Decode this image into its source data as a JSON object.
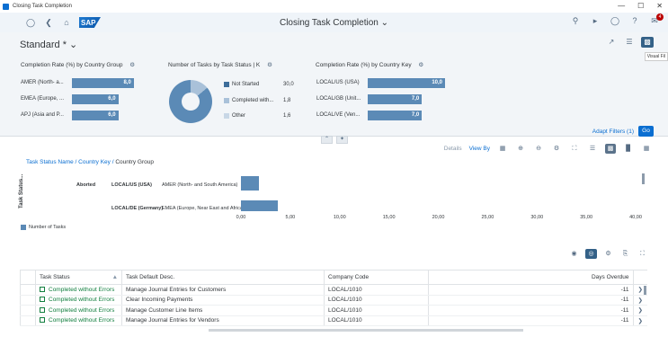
{
  "window": {
    "title": "Closing Task Completion",
    "controls": [
      "—",
      "☐",
      "✕"
    ]
  },
  "shell": {
    "logo": "SAP",
    "title": "Closing Task Completion",
    "notification_count": "4",
    "icons": [
      "user-icon",
      "back-icon",
      "home-icon",
      "search-icon",
      "megaphone-icon",
      "help-icon",
      "question-icon",
      "notifications-icon"
    ]
  },
  "header": {
    "variant": "Standard *",
    "tooltip": "Visual Fil",
    "adapt_filters": "Adapt Filters (1)",
    "go": "Go"
  },
  "cards": {
    "group": {
      "title": "Completion Rate (%) by Country Group",
      "items": [
        {
          "label": "AMER (North- a...",
          "value": "8,0",
          "fraction": 0.8
        },
        {
          "label": "EMEA (Europe, ...",
          "value": "6,0",
          "fraction": 0.6
        },
        {
          "label": "APJ (Asia and P...",
          "value": "6,0",
          "fraction": 0.6
        }
      ]
    },
    "status": {
      "title": "Number of Tasks by Task Status | K",
      "items": [
        {
          "label": "Not Started",
          "value": "30,0",
          "color": "#3d6d9a"
        },
        {
          "label": "Completed with...",
          "value": "1,8",
          "color": "#a9c1d9"
        },
        {
          "label": "Other",
          "value": "1,6",
          "color": "#c8d7e6"
        }
      ]
    },
    "key": {
      "title": "Completion Rate (%) by Country Key",
      "items": [
        {
          "label": "LOCAL/US (USA)",
          "value": "10,0",
          "fraction": 1.0
        },
        {
          "label": "LOCAL/GB (Unit...",
          "value": "7,0",
          "fraction": 0.7
        },
        {
          "label": "LOCAL/VE (Ven...",
          "value": "7,0",
          "fraction": 0.7
        }
      ]
    }
  },
  "chart_toolbar": {
    "details": "Details",
    "view_by": "View By"
  },
  "drilldown": {
    "path": "Task Status Name / Country Key / ",
    "current": "Country Group"
  },
  "chart_data": {
    "type": "bar",
    "ylabel": "Task Status...",
    "legend": "Number of Tasks",
    "rows": [
      {
        "status": "Aborted",
        "key": "LOCAL/US (USA)",
        "group": "AMER (North- and South America)",
        "value": 1.8
      },
      {
        "status": "",
        "key": "LOCAL/DE (Germany)",
        "group": "EMEA (Europe, Near East and Africa)",
        "value": 3.7
      }
    ],
    "xticks": [
      "0,00",
      "5,00",
      "10,00",
      "15,00",
      "20,00",
      "25,00",
      "30,00",
      "35,00",
      "40,00"
    ],
    "xlim": [
      0,
      40
    ]
  },
  "table": {
    "columns": [
      "Task Status",
      "Task Default Desc.",
      "Company Code",
      "Days Overdue"
    ],
    "rows": [
      {
        "status": "Completed without Errors",
        "desc": "Manage Journal Entries for Customers",
        "company": "LOCAL/1010",
        "days": "-11"
      },
      {
        "status": "Completed without Errors",
        "desc": "Clear Incoming Payments",
        "company": "LOCAL/1010",
        "days": "-11"
      },
      {
        "status": "Completed without Errors",
        "desc": "Manage Customer Line Items",
        "company": "LOCAL/1010",
        "days": "-11"
      },
      {
        "status": "Completed without Errors",
        "desc": "Manage Journal Entries for Vendors",
        "company": "LOCAL/1010",
        "days": "-11"
      }
    ]
  }
}
